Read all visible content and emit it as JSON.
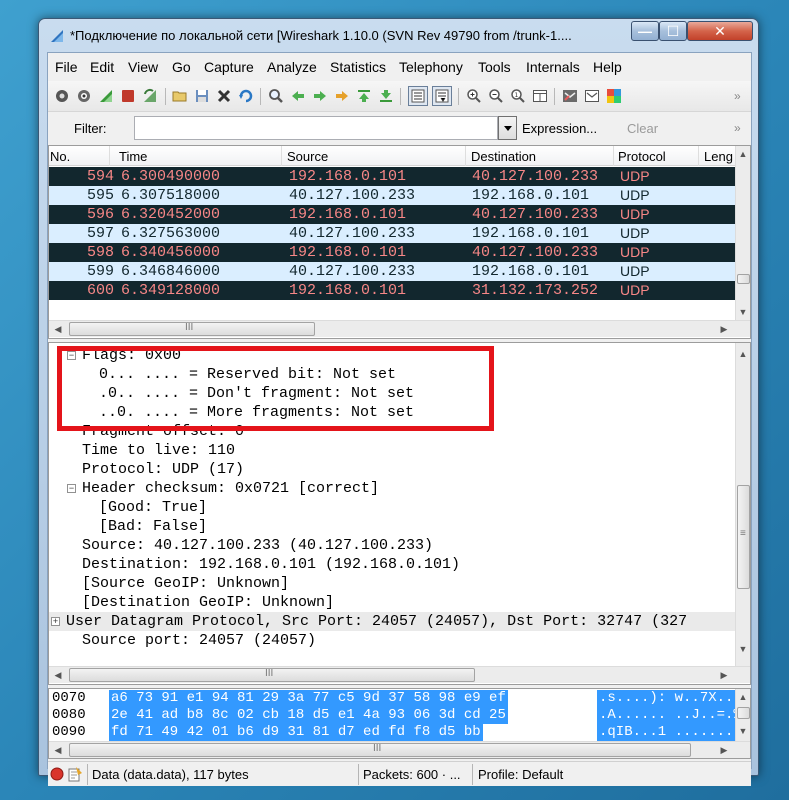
{
  "window": {
    "title": "*Подключение по локальной сети   [Wireshark 1.10.0  (SVN Rev 49790 from /trunk-1....",
    "minimize_label": "—",
    "maximize_label": "☐",
    "close_label": "✕"
  },
  "menu": {
    "items": [
      "File",
      "Edit",
      "View",
      "Go",
      "Capture",
      "Analyze",
      "Statistics",
      "Telephony",
      "Tools",
      "Internals",
      "Help"
    ]
  },
  "toolbar": {
    "icons": [
      "interface-list-icon",
      "capture-options-icon",
      "start-capture-icon",
      "stop-capture-icon",
      "restart-capture-icon",
      "open-file-icon",
      "save-file-icon",
      "close-file-icon",
      "reload-icon",
      "find-packet-icon",
      "go-back-icon",
      "go-forward-icon",
      "go-to-packet-icon",
      "go-first-icon",
      "go-last-icon",
      "colorize-icon",
      "autoscroll-icon",
      "zoom-in-icon",
      "zoom-out-icon",
      "zoom-normal-icon",
      "resize-columns-icon",
      "capture-filters-icon",
      "display-filters-icon",
      "coloring-rules-icon"
    ],
    "overflow_label": "»"
  },
  "filter": {
    "label": "Filter:",
    "value": "",
    "expression_label": "Expression...",
    "clear_label": "Clear",
    "overflow_label": "»"
  },
  "packet_list": {
    "columns": [
      "No.",
      "Time",
      "Source",
      "Destination",
      "Protocol",
      "Leng"
    ],
    "rows": [
      {
        "no": "594",
        "time": "6.300490000",
        "source": "192.168.0.101",
        "destination": "40.127.100.233",
        "protocol": "UDP",
        "style": "dark"
      },
      {
        "no": "595",
        "time": "6.307518000",
        "source": "40.127.100.233",
        "destination": "192.168.0.101",
        "protocol": "UDP",
        "style": "light"
      },
      {
        "no": "596",
        "time": "6.320452000",
        "source": "192.168.0.101",
        "destination": "40.127.100.233",
        "protocol": "UDP",
        "style": "dark"
      },
      {
        "no": "597",
        "time": "6.327563000",
        "source": "40.127.100.233",
        "destination": "192.168.0.101",
        "protocol": "UDP",
        "style": "light"
      },
      {
        "no": "598",
        "time": "6.340456000",
        "source": "192.168.0.101",
        "destination": "40.127.100.233",
        "protocol": "UDP",
        "style": "dark"
      },
      {
        "no": "599",
        "time": "6.346846000",
        "source": "40.127.100.233",
        "destination": "192.168.0.101",
        "protocol": "UDP",
        "style": "light"
      },
      {
        "no": "600",
        "time": "6.349128000",
        "source": "192.168.0.101",
        "destination": "31.132.173.252",
        "protocol": "UDP",
        "style": "dark"
      }
    ],
    "hscroll_grip": "III"
  },
  "details": {
    "lines": [
      {
        "text": "Flags: 0x00",
        "indent": 1,
        "expander": "minus"
      },
      {
        "text": "0... .... = Reserved bit: Not set",
        "indent": 3
      },
      {
        "text": ".0.. .... = Don't fragment: Not set",
        "indent": 3
      },
      {
        "text": "..0. .... = More fragments: Not set",
        "indent": 3
      },
      {
        "text": "Fragment offset: 0",
        "indent": 2
      },
      {
        "text": "Time to live: 110",
        "indent": 2
      },
      {
        "text": "Protocol: UDP (17)",
        "indent": 2
      },
      {
        "text": "Header checksum: 0x0721 [correct]",
        "indent": 1,
        "expander": "minus"
      },
      {
        "text": "[Good: True]",
        "indent": 3
      },
      {
        "text": "[Bad: False]",
        "indent": 3
      },
      {
        "text": "Source: 40.127.100.233 (40.127.100.233)",
        "indent": 2
      },
      {
        "text": "Destination: 192.168.0.101 (192.168.0.101)",
        "indent": 2
      },
      {
        "text": "[Source GeoIP: Unknown]",
        "indent": 2
      },
      {
        "text": "[Destination GeoIP: Unknown]",
        "indent": 2
      },
      {
        "text": "User Datagram Protocol, Src Port: 24057 (24057), Dst Port: 32747 (327",
        "indent": 0,
        "expander": "plus",
        "selected": true
      },
      {
        "text": "Source port: 24057 (24057)",
        "indent": 2
      }
    ],
    "hscroll_grip": "III",
    "vscroll_grip": "≡"
  },
  "hex": {
    "lines": [
      {
        "offset": "0070",
        "bytes": "a6 73 91 e1 94 81 29 3a  77 c5 9d 37 58 98 e9 ef",
        "ascii": ".s....):  w..7X.."
      },
      {
        "offset": "0080",
        "bytes": "2e 41 ad b8 8c 02 cb 18  d5 e1 4a 93 06 3d cd 25",
        "ascii": ".A......  ..J..=.%"
      },
      {
        "offset": "0090",
        "bytes": "fd 71 49 42 01 b6 d9 31  81 d7 ed fd f8 d5 bb",
        "ascii": ".qIB...1  ......."
      }
    ],
    "hscroll_grip": "III"
  },
  "status": {
    "data_text": "Data (data.data), 117 bytes",
    "packets_text": "Packets: 600 · ...",
    "profile_text": "Profile: Default"
  },
  "colors": {
    "dark_row_bg": "#12272e",
    "dark_row_fg": "#f78787",
    "light_row_bg": "#daeeff",
    "hex_selection": "#3399ff",
    "highlight_box": "#e4141a"
  }
}
